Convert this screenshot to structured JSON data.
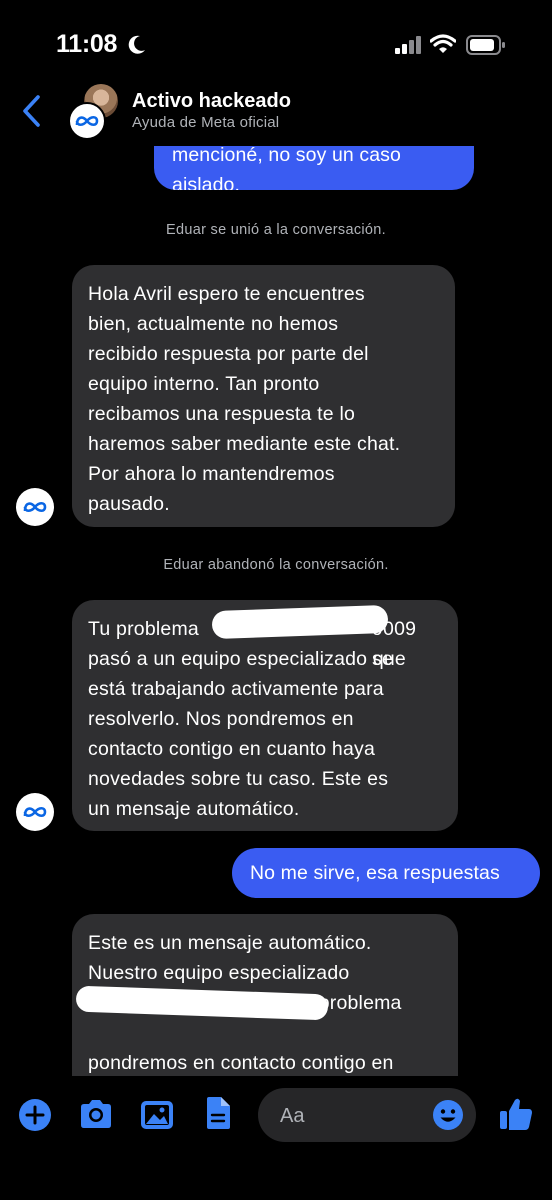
{
  "status_bar": {
    "time": "11:08",
    "icons": [
      "moon-icon",
      "signal-icon",
      "wifi-icon",
      "battery-icon"
    ]
  },
  "header": {
    "title": "Activo hackeado",
    "subtitle": "Ayuda de Meta oficial",
    "icons": [
      "back-chevron-icon",
      "avatar",
      "meta-logo-icon"
    ]
  },
  "messages": [
    {
      "type": "outgoing",
      "text": "mencioné, no soy un caso aislado."
    },
    {
      "type": "notice",
      "text": "Eduar se unió a la conversación."
    },
    {
      "type": "incoming",
      "lines": [
        "Hola Avril espero te encuentres",
        "bien, actualmente no hemos",
        "recibido respuesta por parte del",
        "equipo interno. Tan pronto",
        "recibamos una respuesta te lo",
        "haremos saber mediante este chat.",
        "Por ahora lo mantendremos",
        "pausado."
      ]
    },
    {
      "type": "notice",
      "text": "Eduar abandonó la conversación."
    },
    {
      "type": "incoming",
      "lines": [
        "Tu problema",
        "pasó a un equipo especializado que",
        "está trabajando activamente para",
        "resolverlo. Nos pondremos en",
        "contacto contigo en cuanto haya",
        "novedades sobre tu caso. Este es",
        "un mensaje automático."
      ],
      "visible_fragment": "9009 se"
    },
    {
      "type": "outgoing",
      "text": "No me sirve, esa respuestas"
    },
    {
      "type": "incoming",
      "lines": [
        "Este es un mensaje automático.",
        "Nuestro equipo especializado",
        "continúa trabajando en tu problema",
        "",
        "pondremos en contacto contigo en"
      ]
    }
  ],
  "composer": {
    "placeholder": "Aa",
    "icons": [
      "plus-icon",
      "camera-icon",
      "gallery-icon",
      "file-icon",
      "emoji-icon",
      "thumbs-up-icon"
    ]
  },
  "colors": {
    "accent": "#3a5cf2",
    "incoming_bubble": "#2f2f31",
    "background": "#000000",
    "icon_blue": "#3b82f6"
  }
}
